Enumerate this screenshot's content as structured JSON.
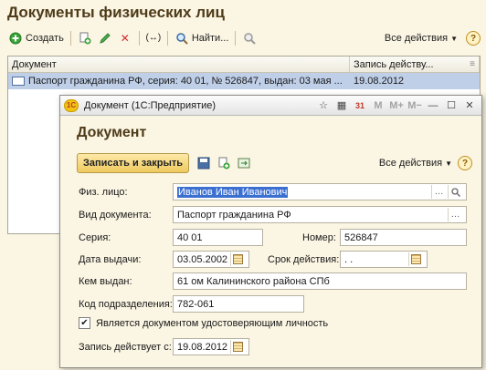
{
  "background": {
    "title": "Документы физических лиц",
    "toolbar": {
      "create_label": "Создать",
      "find_label": "Найти...",
      "all_actions_label": "Все действия"
    },
    "list": {
      "columns": [
        "Документ",
        "Запись действу..."
      ],
      "rows": [
        {
          "document": "Паспорт гражданина РФ, серия: 40 01, № 526847, выдан: 03 мая ...",
          "date": "19.08.2012"
        }
      ]
    }
  },
  "dialog": {
    "window_title": "Документ  (1С:Предприятие)",
    "logo_text": "1С",
    "heading": "Документ",
    "save_close_label": "Записать и закрыть",
    "all_actions_label": "Все действия",
    "fields": {
      "person": {
        "label": "Физ. лицо:",
        "value": "Иванов Иван Иванович"
      },
      "doc_type": {
        "label": "Вид документа:",
        "value": "Паспорт гражданина РФ"
      },
      "series": {
        "label": "Серия:",
        "value": "40 01"
      },
      "number": {
        "label": "Номер:",
        "value": "526847"
      },
      "issue_date": {
        "label": "Дата выдачи:",
        "value": "03.05.2002"
      },
      "valid_until": {
        "label": "Срок действия:",
        "value": " .  ."
      },
      "issued_by": {
        "label": "Кем выдан:",
        "value": "61 ом Калининского района СПб"
      },
      "dept_code": {
        "label": "Код подразделения:",
        "value": "782-061"
      },
      "is_identity": {
        "label": "Является документом удостоверяющим личность",
        "checked": true
      },
      "record_from": {
        "label": "Запись действует с:",
        "value": "19.08.2012"
      }
    }
  },
  "colors": {
    "accent_title": "#4e3b19",
    "selection": "#bfcfe8",
    "primary_button": "#f2d27a"
  }
}
